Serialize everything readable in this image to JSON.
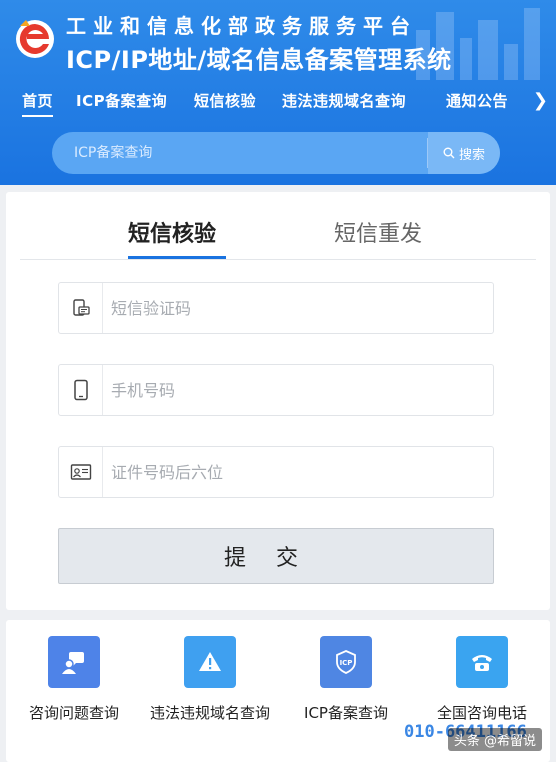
{
  "header": {
    "title_line1": "工业和信息化部政务服务平台",
    "title_line2": "ICP/IP地址/域名信息备案管理系统",
    "nav": [
      {
        "label": "首页"
      },
      {
        "label": "ICP备案查询"
      },
      {
        "label": "短信核验"
      },
      {
        "label": "违法违规域名查询"
      },
      {
        "label": "通知公告"
      }
    ],
    "nav_more": "❯",
    "search": {
      "placeholder": "ICP备案查询",
      "button_label": "搜索"
    }
  },
  "form": {
    "tabs": [
      {
        "label": "短信核验"
      },
      {
        "label": "短信重发"
      }
    ],
    "fields": {
      "code_placeholder": "短信验证码",
      "phone_placeholder": "手机号码",
      "id_placeholder": "证件号码后六位"
    },
    "submit_label": "提交"
  },
  "quick_links": [
    {
      "label": "咨询问题查询",
      "icon": "chat-question-icon",
      "color": "#4e83e8"
    },
    {
      "label": "违法违规域名查询",
      "icon": "warning-icon",
      "color": "#3fa0f0"
    },
    {
      "label": "ICP备案查询",
      "icon": "shield-icp-icon",
      "color": "#4f86e3"
    },
    {
      "label": "全国咨询电话",
      "icon": "telephone-icon",
      "color": "#3aa4f0"
    }
  ],
  "hotline": "010-66411166",
  "watermark": "头条 @希留说",
  "colors": {
    "primary": "#1a73e0",
    "header_light": "#2f8be9"
  }
}
